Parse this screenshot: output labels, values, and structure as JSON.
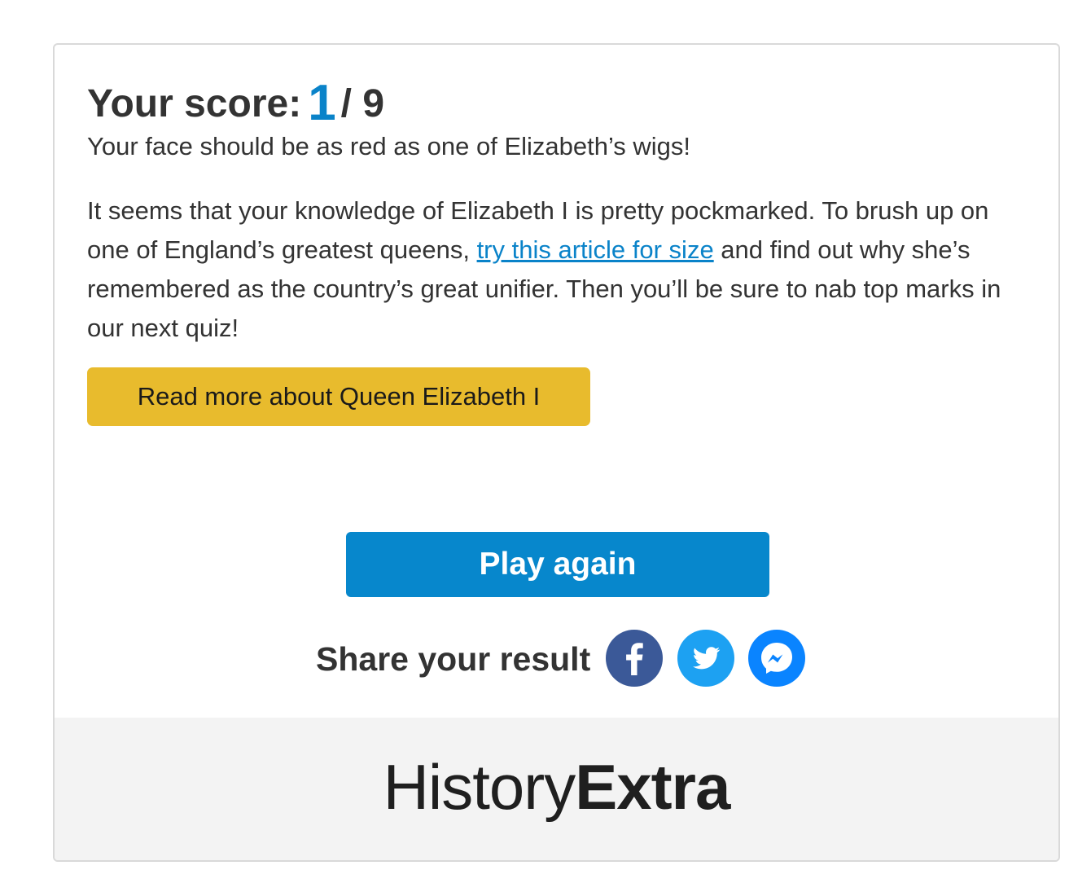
{
  "result": {
    "score_label": "Your score:",
    "score_value": "1",
    "score_total": "/ 9",
    "verdict": "Your face should be as red as one of Elizabeth’s wigs!",
    "paragraph_before_link": "It seems that your knowledge of Elizabeth I is pretty pockmarked. To brush up on one of England’s greatest queens, ",
    "link_text": "try this article for size",
    "paragraph_after_link": " and find out why she’s remembered as the country’s great unifier. Then you’ll be sure to nab top marks in our next quiz!",
    "read_more_label": "Read more about Queen Elizabeth I"
  },
  "actions": {
    "play_again_label": "Play again",
    "share_label": "Share your result",
    "share_icons": [
      "facebook-icon",
      "twitter-icon",
      "messenger-icon"
    ]
  },
  "footer": {
    "logo_light": "History",
    "logo_bold": "Extra"
  },
  "colors": {
    "accent_blue": "#0787cc",
    "button_yellow": "#e8bb2d",
    "facebook": "#3b5998",
    "twitter": "#1da1f2",
    "messenger": "#0a84ff"
  }
}
